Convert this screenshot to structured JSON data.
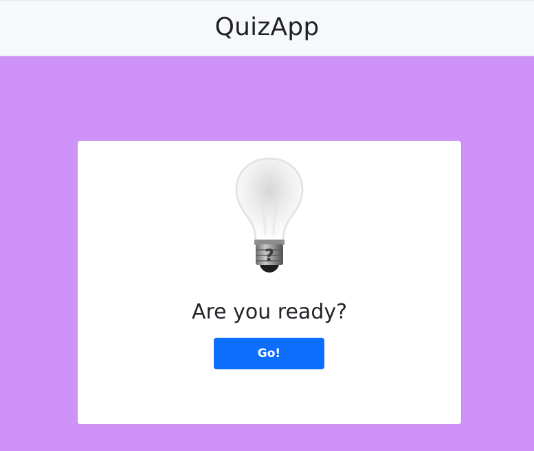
{
  "header": {
    "title": "QuizApp"
  },
  "main": {
    "hero_icon": "lightbulb-question-icon",
    "prompt": "Are you ready?",
    "start_button_label": "Go!"
  },
  "colors": {
    "header_bg": "#f7f8fa",
    "page_bg": "#cf92f8",
    "card_bg": "#ffffff",
    "button_bg": "#0d6efd",
    "button_text": "#ffffff",
    "text": "#212529"
  }
}
